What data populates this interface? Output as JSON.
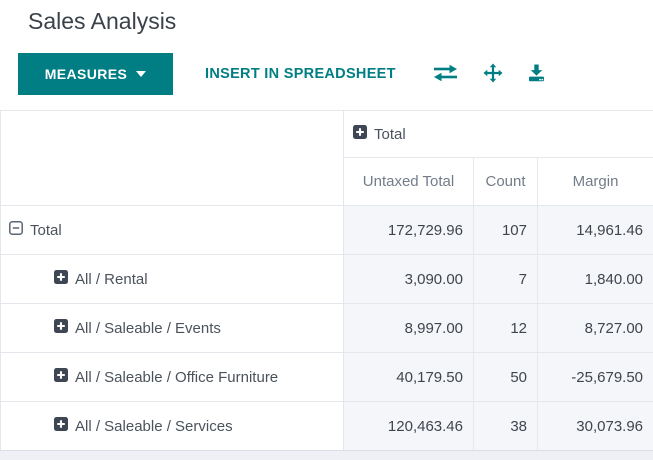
{
  "page": {
    "title": "Sales Analysis"
  },
  "toolbar": {
    "measures_label": "MEASURES",
    "insert_label": "INSERT IN SPREADSHEET",
    "icons": [
      "flip-axis-icon",
      "expand-all-icon",
      "download-icon"
    ],
    "accent_color": "#017e84"
  },
  "pivot": {
    "column_group": {
      "label": "Total"
    },
    "measures": [
      "Untaxed Total",
      "Count",
      "Margin"
    ],
    "rows": [
      {
        "label": "Total",
        "state": "expanded",
        "values": [
          "172,729.96",
          "107",
          "14,961.46"
        ]
      },
      {
        "label": "All / Rental",
        "state": "collapsed",
        "values": [
          "3,090.00",
          "7",
          "1,840.00"
        ]
      },
      {
        "label": "All / Saleable / Events",
        "state": "collapsed",
        "values": [
          "8,997.00",
          "12",
          "8,727.00"
        ]
      },
      {
        "label": "All / Saleable / Office Furniture",
        "state": "collapsed",
        "values": [
          "40,179.50",
          "50",
          "-25,679.50"
        ]
      },
      {
        "label": "All / Saleable / Services",
        "state": "collapsed",
        "values": [
          "120,463.46",
          "38",
          "30,073.96"
        ]
      }
    ]
  }
}
